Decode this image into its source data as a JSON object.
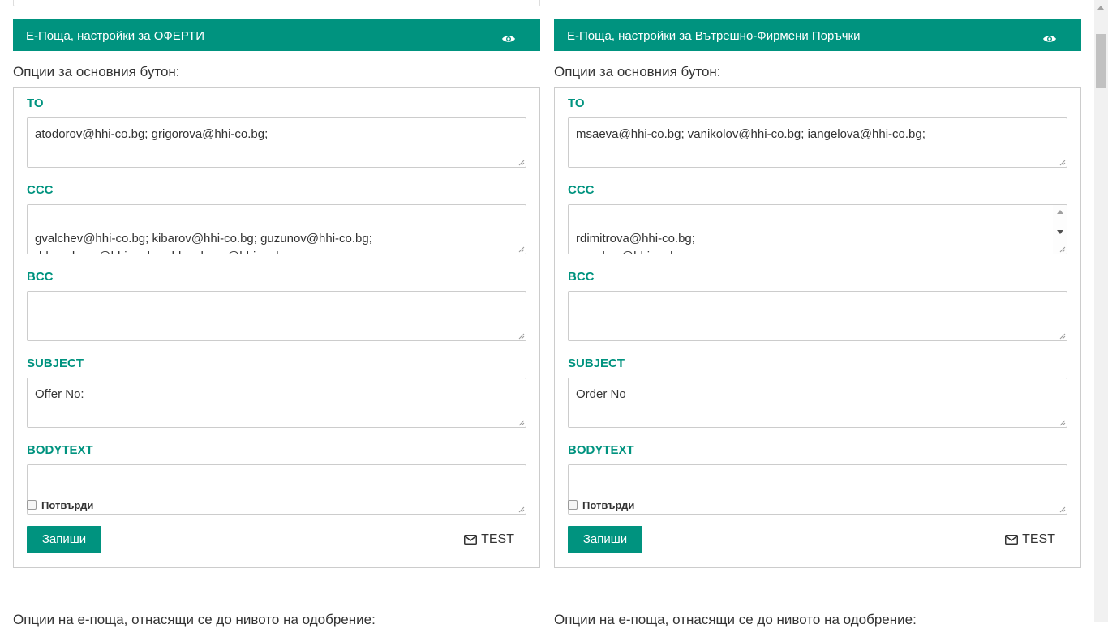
{
  "panels": [
    {
      "header_title": "Е-Поща, настройки за ОФЕРТИ",
      "section_label": "Опции за основния бутон:",
      "fields": [
        {
          "label": "TO",
          "value": "atodorov@hhi-co.bg; grigorova@hhi-co.bg;"
        },
        {
          "label": "CCC",
          "value": "gvalchev@hhi-co.bg; kibarov@hhi-co.bg; guzunov@hhi-co.bg;\nddrencheva@hhi-co.bg; ddancheva@hhi-co.bg;"
        },
        {
          "label": "BCC",
          "value": ""
        },
        {
          "label": "SUBJECT",
          "value": "Offer No:"
        },
        {
          "label": "BODYTEXT",
          "value": ""
        }
      ],
      "confirm_label": "Потвърди",
      "save_label": "Запиши",
      "test_label": "TEST"
    },
    {
      "header_title": "Е-Поща, настройки за Вътрешно-Фирмени Поръчки",
      "section_label": "Опции за основния бутон:",
      "fields": [
        {
          "label": "TO",
          "value": "msaeva@hhi-co.bg; vanikolov@hhi-co.bg; iangelova@hhi-co.bg;"
        },
        {
          "label": "CCC",
          "value": "rdimitrova@hhi-co.bg;\nppaskov@hhi-co.bg;"
        },
        {
          "label": "BCC",
          "value": ""
        },
        {
          "label": "SUBJECT",
          "value": "Order No"
        },
        {
          "label": "BODYTEXT",
          "value": ""
        }
      ],
      "confirm_label": "Потвърди",
      "save_label": "Запиши",
      "test_label": "TEST"
    }
  ],
  "bottom": {
    "left_text": "Опции на е-поща, отнасящи се до нивото на одобрение:",
    "right_text": "Опции на е-поща, отнасящи се до нивото на одобрение:"
  },
  "colors": {
    "accent": "#00937f",
    "border": "#cccccc",
    "text": "#333333"
  },
  "icons": {
    "header": "eye-icon",
    "test": "envelope-icon"
  }
}
